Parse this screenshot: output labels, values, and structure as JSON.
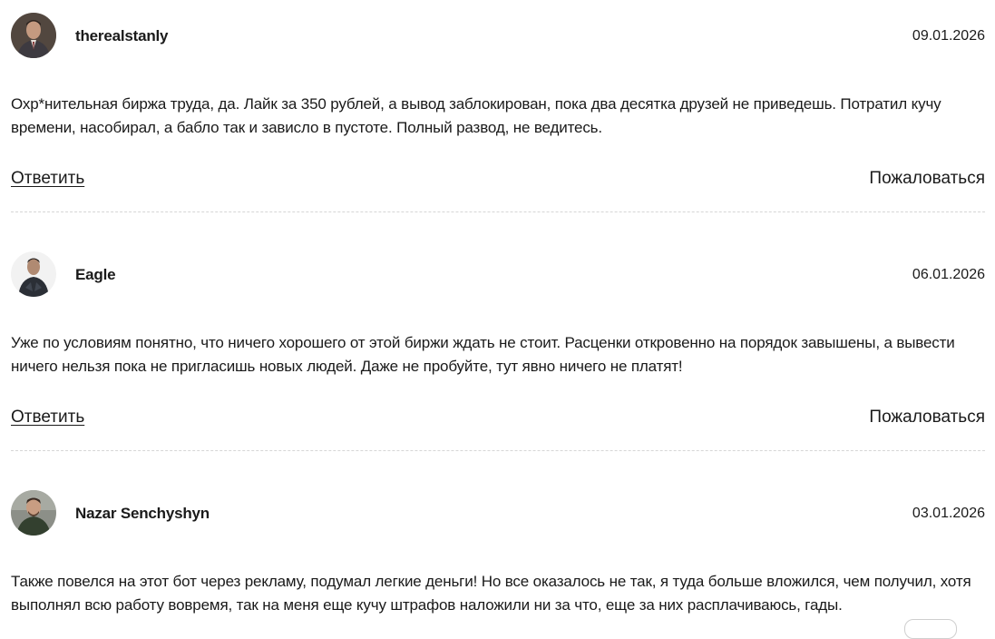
{
  "comments": [
    {
      "username": "therealstanly",
      "date": "09.01.2026",
      "text": "Охр*нительная биржа труда, да. Лайк за 350 рублей, а вывод заблокирован, пока два десятка друзей не приведешь. Потратил кучу времени, насобирал, а бабло так и зависло в пустоте. Полный развод, не ведитесь.",
      "reply_label": "Ответить",
      "report_label": "Пожаловаться"
    },
    {
      "username": "Eagle",
      "date": "06.01.2026",
      "text": "Уже по условиям понятно, что ничего хорошего от этой биржи ждать не стоит. Расценки откровенно на порядок завышены, а вывести ничего нельзя пока не пригласишь новых людей. Даже не пробуйте, тут явно ничего не платят!",
      "reply_label": "Ответить",
      "report_label": "Пожаловаться"
    },
    {
      "username": "Nazar Senchyshyn",
      "date": "03.01.2026",
      "text": "Также повелся на этот бот через рекламу, подумал легкие деньги! Но все оказалось не так, я туда больше вложился, чем получил, хотя выполнял всю работу вовремя, так на меня еще кучу штрафов наложили ни за что, еще за них расплачиваюсь, гады."
    }
  ]
}
